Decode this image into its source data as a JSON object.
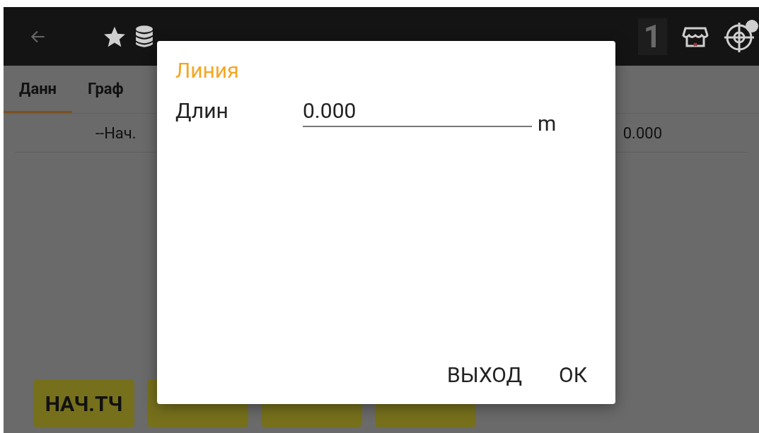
{
  "toolbar": {
    "count": "1"
  },
  "tabs": [
    {
      "label": "Данн",
      "selected": true
    },
    {
      "label": "Граф",
      "selected": false
    }
  ],
  "row": {
    "start": "--Нач.",
    "value": "0.000"
  },
  "buttons": [
    {
      "kind": "labeled",
      "label": "НАЧ.ТЧ"
    },
    {
      "kind": "blank"
    },
    {
      "kind": "blank"
    },
    {
      "kind": "blank"
    }
  ],
  "dialog": {
    "title": "Линия",
    "field_label": "Длин",
    "value": "0.000",
    "unit": "m",
    "actions": [
      "ВЫХОД",
      "ОК"
    ]
  }
}
